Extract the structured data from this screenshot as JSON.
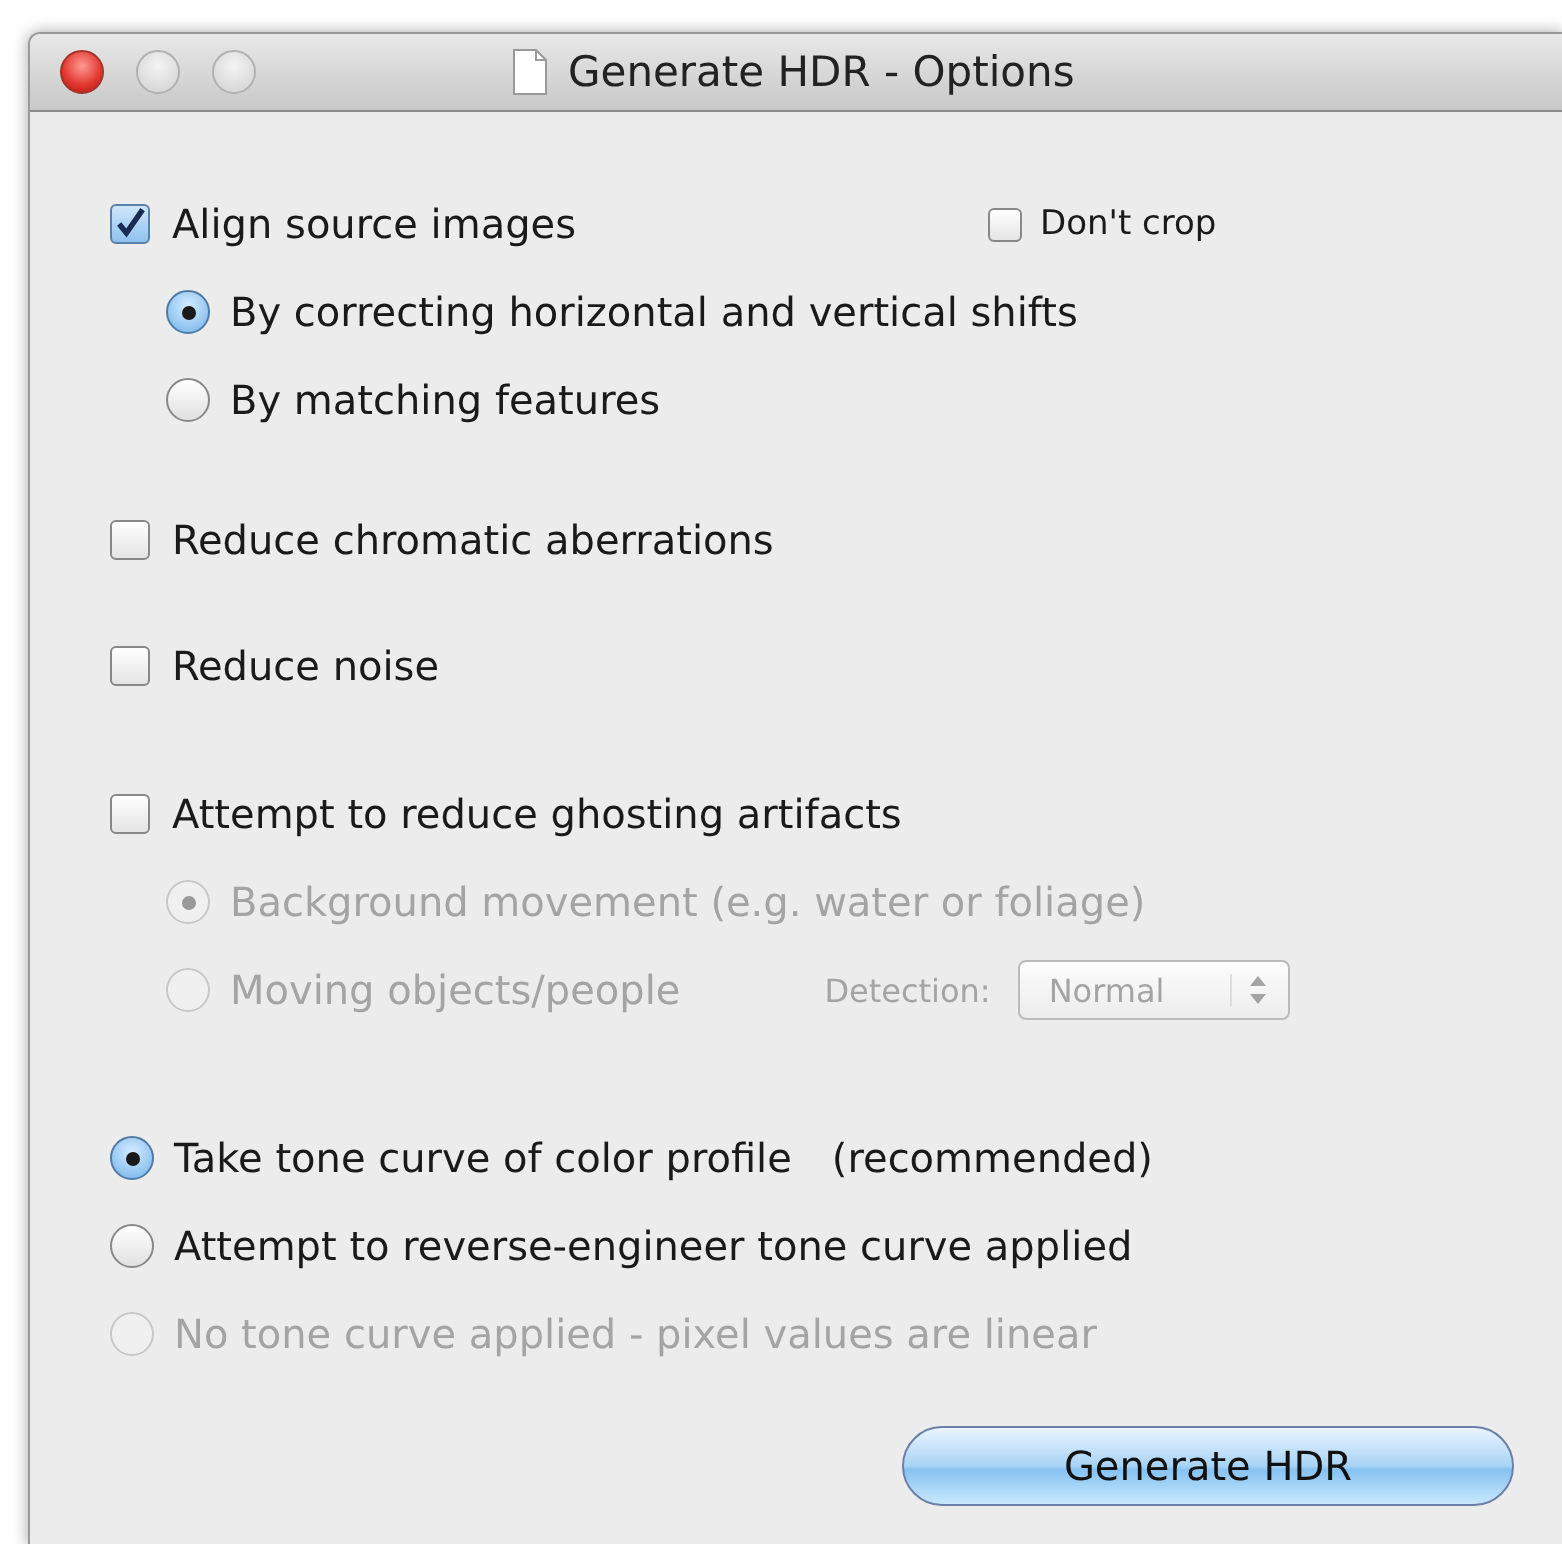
{
  "window": {
    "title": "Generate HDR - Options"
  },
  "groups": [
    {
      "items": [
        {
          "kind": "checkbox",
          "label": "Align source images",
          "checked": true,
          "disabled": false,
          "aside": {
            "kind": "checkbox",
            "label": "Don't crop",
            "checked": false,
            "disabled": false
          },
          "children": [
            {
              "kind": "radio",
              "label": "By correcting horizontal and vertical shifts",
              "selected": true,
              "disabled": false
            },
            {
              "kind": "radio",
              "label": "By matching features",
              "selected": false,
              "disabled": false
            }
          ]
        }
      ]
    },
    {
      "items": [
        {
          "kind": "checkbox",
          "label": "Reduce chromatic aberrations",
          "checked": false,
          "disabled": false
        }
      ]
    },
    {
      "items": [
        {
          "kind": "checkbox",
          "label": "Reduce noise",
          "checked": false,
          "disabled": false
        }
      ]
    },
    {
      "items": [
        {
          "kind": "checkbox",
          "label": "Attempt to reduce ghosting artifacts",
          "checked": false,
          "disabled": false,
          "children": [
            {
              "kind": "radio",
              "label": "Background movement (e.g. water or foliage)",
              "selected": true,
              "disabled": true
            },
            {
              "kind": "radio",
              "label": "Moving objects/people",
              "selected": false,
              "disabled": true,
              "popup": {
                "label": "Detection:",
                "value": "Normal",
                "disabled": true
              }
            }
          ]
        }
      ]
    },
    {
      "items": [
        {
          "kind": "radio",
          "label": "Take tone curve of color profile",
          "note": "(recommended)",
          "selected": true,
          "disabled": false
        },
        {
          "kind": "radio",
          "label": "Attempt to reverse-engineer tone curve applied",
          "selected": false,
          "disabled": false
        },
        {
          "kind": "radio",
          "label": "No tone curve applied - pixel values are linear",
          "selected": false,
          "disabled": true
        }
      ]
    }
  ],
  "buttons": [
    {
      "label": "Generate HDR",
      "default": true
    }
  ]
}
